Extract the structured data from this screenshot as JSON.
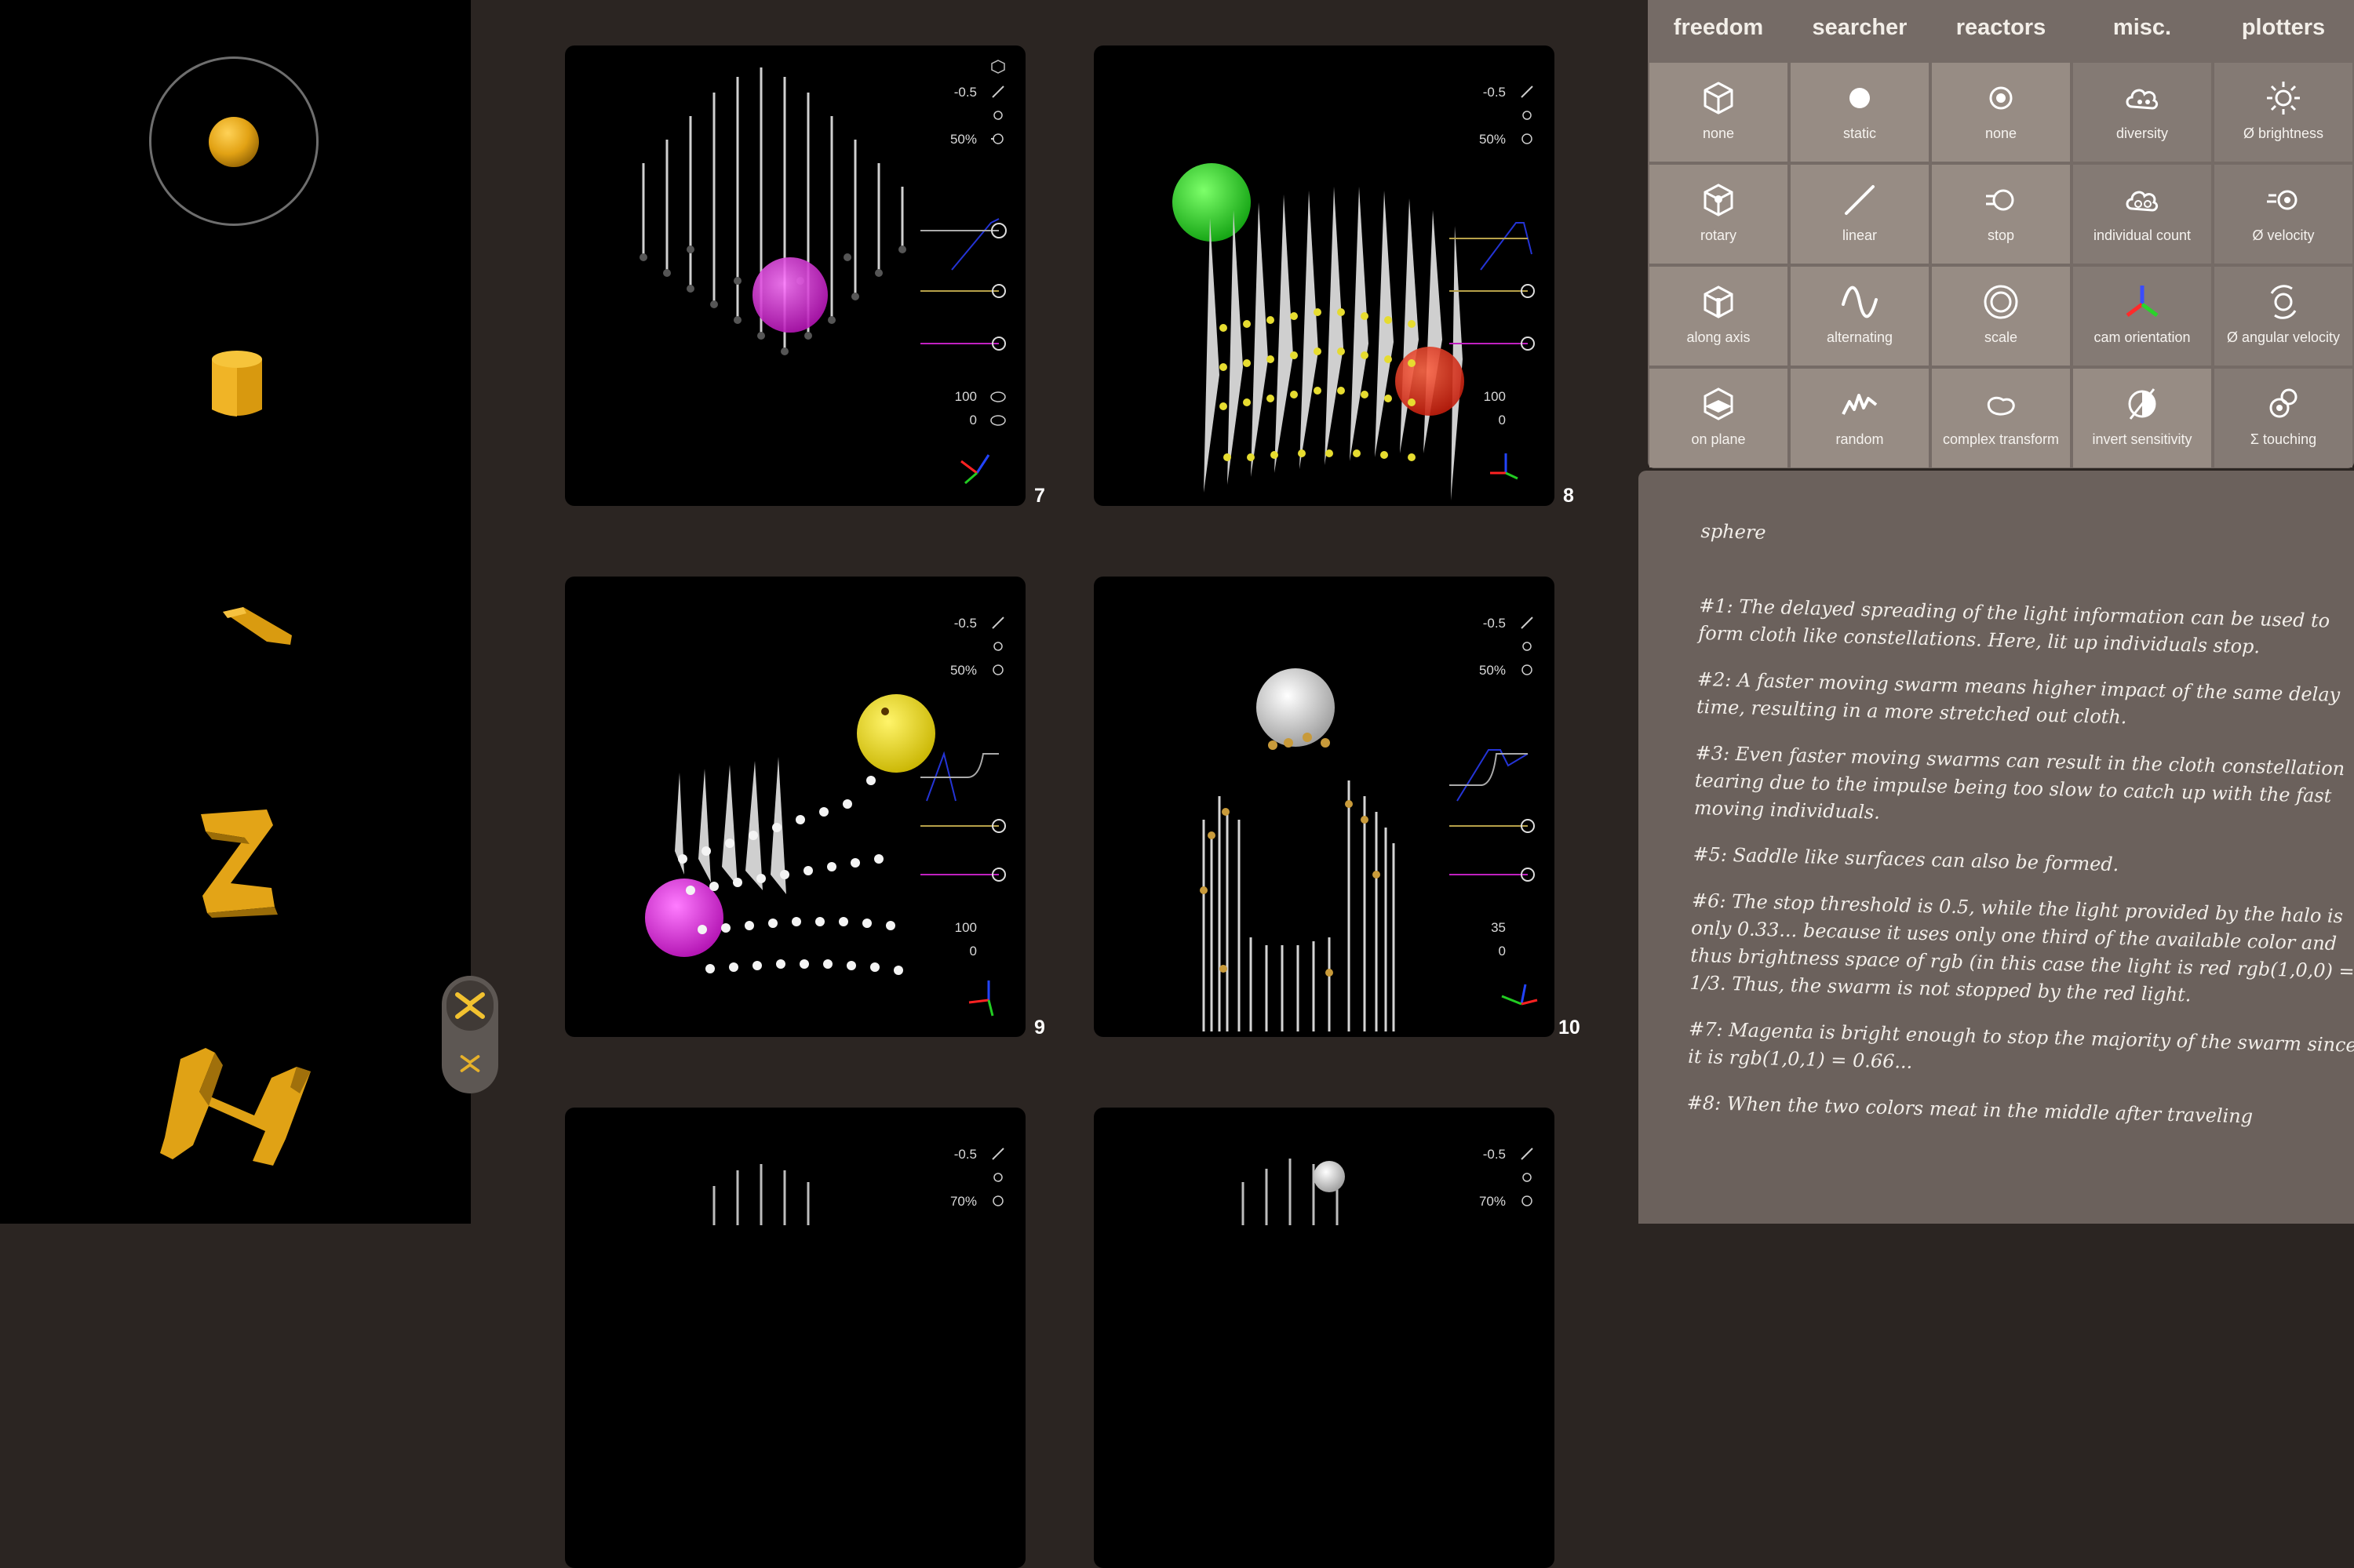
{
  "tabs": [
    "freedom",
    "searcher",
    "reactors",
    "misc.",
    "plotters"
  ],
  "grid": {
    "freedom": [
      {
        "label": "none",
        "icon": "cube-icon"
      },
      {
        "label": "rotary",
        "icon": "cube-rotary-icon"
      },
      {
        "label": "along axis",
        "icon": "cube-axis-icon"
      },
      {
        "label": "on plane",
        "icon": "cube-plane-icon"
      }
    ],
    "searcher": [
      {
        "label": "static",
        "icon": "dot-icon"
      },
      {
        "label": "linear",
        "icon": "line-icon"
      },
      {
        "label": "alternating",
        "icon": "wave-icon"
      },
      {
        "label": "random",
        "icon": "zigzag-icon"
      }
    ],
    "reactors": [
      {
        "label": "none",
        "icon": "ring-dot-icon"
      },
      {
        "label": "stop",
        "icon": "stop-icon"
      },
      {
        "label": "scale",
        "icon": "scale-icon"
      },
      {
        "label": "complex transform",
        "icon": "blob-icon"
      }
    ],
    "misc": [
      {
        "label": "diversity",
        "icon": "cloud-icon"
      },
      {
        "label": "individual count",
        "icon": "cloud-count-icon"
      },
      {
        "label": "cam orientation",
        "icon": "axes-icon"
      },
      {
        "label": "invert sensitivity",
        "icon": "invert-icon"
      }
    ],
    "plotters": [
      {
        "label": "Ø brightness",
        "icon": "sun-icon"
      },
      {
        "label": "Ø velocity",
        "icon": "velocity-icon"
      },
      {
        "label": "Ø angular velocity",
        "icon": "angular-velocity-icon"
      },
      {
        "label": "Σ touching",
        "icon": "touching-icon"
      }
    ]
  },
  "tiles": [
    {
      "number": "7",
      "threshold": "-0.5",
      "halo": "50%",
      "count": "100",
      "diversity": "0"
    },
    {
      "number": "8",
      "threshold": "-0.5",
      "halo": "50%",
      "count": "100",
      "diversity": "0"
    },
    {
      "number": "9",
      "threshold": "-0.5",
      "halo": "50%",
      "count": "100",
      "diversity": "0"
    },
    {
      "number": "10",
      "threshold": "-0.5",
      "halo": "50%",
      "count": "35",
      "diversity": "0"
    },
    {
      "number": "",
      "threshold": "-0.5",
      "halo": "70%",
      "count": "",
      "diversity": ""
    },
    {
      "number": "",
      "threshold": "-0.5",
      "halo": "70%",
      "count": "",
      "diversity": ""
    }
  ],
  "notes": {
    "title": "sphere",
    "paragraphs": [
      "#1: The delayed spreading of the light information can be used to form cloth like constellations. Here, lit up individuals stop.",
      "#2: A faster moving swarm means higher impact of the same delay time, resulting in a more stretched out cloth.",
      "#3: Even faster moving swarms can result in the cloth constellation tearing due to the impulse being too slow to catch up with the fast moving individuals.",
      "#5: Saddle like surfaces can also be formed.",
      "#6: The stop threshold is 0.5, while the light provided by the halo is only 0.33... because it uses only one third of the available color and thus brightness space of rgb (in this case the light is red rgb(1,0,0) = 1/3. Thus, the swarm is not stopped by the red light.",
      "#7: Magenta is bright enough to stop the majority of the swarm since it is rgb(1,0,1) = 0.66...",
      "#8: When the two colors meat in the middle after traveling"
    ]
  },
  "colors": {
    "background": "#2b2522",
    "panel": "#756b66",
    "cell": "#978c84",
    "accent_gold": "#e8a91c",
    "graph_blue": "#2434d6",
    "graph_olive": "#b7a14a",
    "graph_magenta": "#c020c0"
  }
}
